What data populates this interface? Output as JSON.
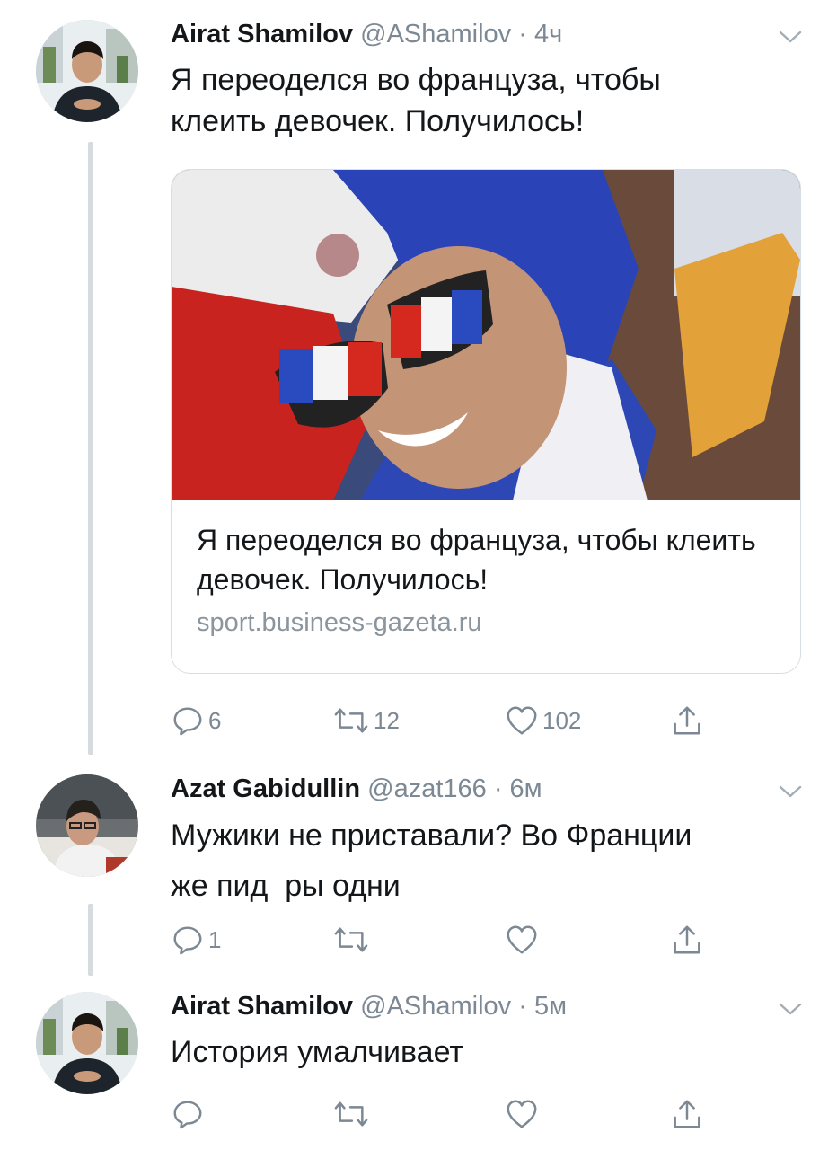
{
  "tweets": [
    {
      "name": "Airat Shamilov",
      "handle": "@AShamilov",
      "time": "· 4ч",
      "text": "Я переоделся во француза, чтобы клеить девочек. Получилось!",
      "card": {
        "title": "Я переоделся во француза, чтобы клеить девочек. Получилось!",
        "url": "sport.business-gazeta.ru"
      },
      "replies": "6",
      "retweets": "12",
      "likes": "102"
    },
    {
      "name": "Azat Gabidullin",
      "handle": "@azat166",
      "time": "· 6м",
      "text_line1": "Мужики не приставали? Во Франции",
      "text_line2": "же пид  ры одни",
      "replies": "1",
      "retweets": "",
      "likes": ""
    },
    {
      "name": "Airat Shamilov",
      "handle": "@AShamilov",
      "time": "· 5м",
      "text": "История умалчивает",
      "replies": "",
      "retweets": "",
      "likes": ""
    }
  ],
  "icons": [
    "reply-icon",
    "retweet-icon",
    "like-icon",
    "share-icon",
    "chevron-down-icon"
  ],
  "colors": {
    "text": "#14171a",
    "secondary": "#7c8893",
    "border": "#d8dde2",
    "thread": "#d6dbdf"
  }
}
